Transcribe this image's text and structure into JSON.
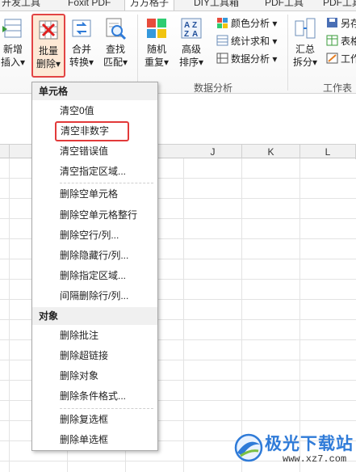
{
  "tabs": [
    "开发工具",
    "Foxit PDF",
    "方方格子",
    "DIY工具箱",
    "PDF工具",
    "PDF工具"
  ],
  "active_tab_index": 2,
  "ribbon": {
    "buttons": [
      {
        "id": "insert",
        "line1": "新增",
        "line2": "插入",
        "arrow": "▾"
      },
      {
        "id": "batch-delete",
        "line1": "批量",
        "line2": "删除",
        "arrow": "▾"
      },
      {
        "id": "merge",
        "line1": "合并",
        "line2": "转换",
        "arrow": "▾"
      },
      {
        "id": "find",
        "line1": "查找",
        "line2": "匹配",
        "arrow": "▾"
      },
      {
        "id": "random",
        "line1": "随机",
        "line2": "重复",
        "arrow": "▾"
      },
      {
        "id": "advanced-sort",
        "line1": "高级",
        "line2": "排序",
        "arrow": "▾"
      },
      {
        "id": "summary",
        "line1": "汇总",
        "line2": "拆分",
        "arrow": "▾"
      }
    ],
    "small_items": [
      "颜色分析",
      "统计求和",
      "数据分析"
    ],
    "right_items": [
      "另存",
      "表格",
      "工作"
    ],
    "groups": [
      "数据分析",
      "工作表"
    ]
  },
  "sheet": {
    "columns": [
      "J",
      "K",
      "L"
    ]
  },
  "menu": {
    "sections": [
      {
        "title": "单元格",
        "items": [
          "清空0值",
          "清空非数字",
          "清空错误值",
          "清空指定区域...",
          "删除空单元格",
          "删除空单元格整行",
          "删除空行/列...",
          "删除隐藏行/列...",
          "删除指定区域...",
          "间隔删除行/列..."
        ]
      },
      {
        "title": "对象",
        "items": [
          "删除批注",
          "删除超链接",
          "删除对象",
          "删除条件格式...",
          "删除复选框",
          "删除单选框"
        ]
      }
    ],
    "highlighted_item": "清空非数字"
  },
  "watermark": {
    "name": "极光下载站",
    "url": "www.xz7.com"
  },
  "colors": {
    "highlight": "#e23a3a",
    "header_bg": "#f0f0f0",
    "brand_blue": "#2f7bd8"
  }
}
